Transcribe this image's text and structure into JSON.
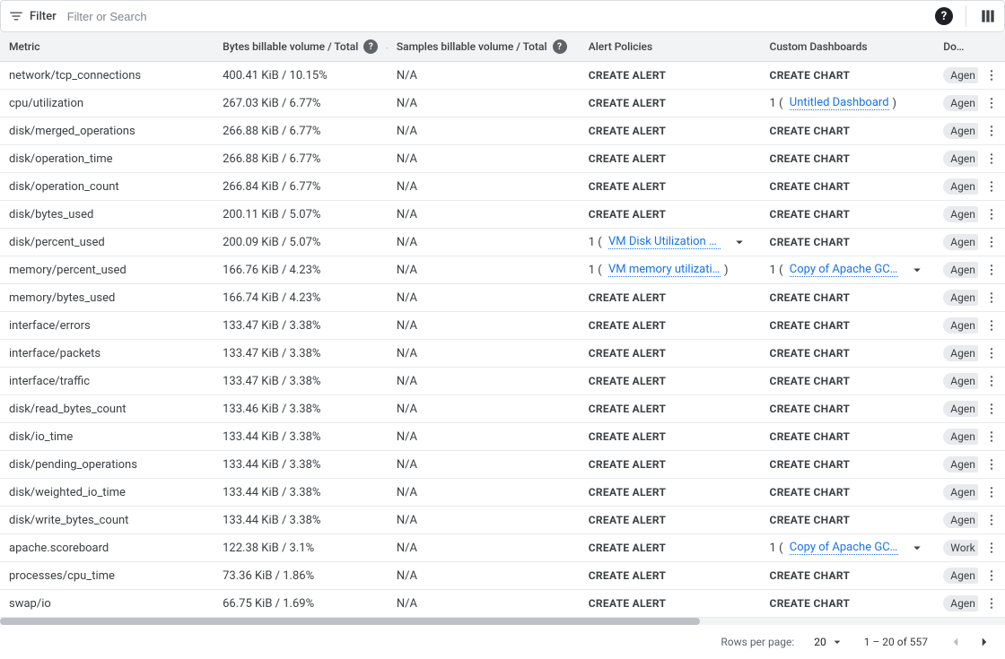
{
  "filter": {
    "label": "Filter",
    "placeholder": "Filter or Search"
  },
  "columns": {
    "metric": "Metric",
    "bytes": "Bytes billable volume / Total",
    "samples": "Samples billable volume / Total",
    "alert": "Alert Policies",
    "dash": "Custom Dashboards",
    "domain": "Domain"
  },
  "labels": {
    "create_alert": "CREATE ALERT",
    "create_chart": "CREATE CHART"
  },
  "rows": [
    {
      "metric": "network/tcp_connections",
      "bytes": "400.41 KiB / 10.15%",
      "samples": "N/A",
      "alert": null,
      "dash": null,
      "domain": "Agen"
    },
    {
      "metric": "cpu/utilization",
      "bytes": "267.03 KiB / 6.77%",
      "samples": "N/A",
      "alert": null,
      "dash": {
        "count": "1",
        "link": "Untitled Dashboard",
        "suffix": ")",
        "expand": false
      },
      "domain": "Agen"
    },
    {
      "metric": "disk/merged_operations",
      "bytes": "266.88 KiB / 6.77%",
      "samples": "N/A",
      "alert": null,
      "dash": null,
      "domain": "Agen"
    },
    {
      "metric": "disk/operation_time",
      "bytes": "266.88 KiB / 6.77%",
      "samples": "N/A",
      "alert": null,
      "dash": null,
      "domain": "Agen"
    },
    {
      "metric": "disk/operation_count",
      "bytes": "266.84 KiB / 6.77%",
      "samples": "N/A",
      "alert": null,
      "dash": null,
      "domain": "Agen"
    },
    {
      "metric": "disk/bytes_used",
      "bytes": "200.11 KiB / 5.07%",
      "samples": "N/A",
      "alert": null,
      "dash": null,
      "domain": "Agen"
    },
    {
      "metric": "disk/percent_used",
      "bytes": "200.09 KiB / 5.07%",
      "samples": "N/A",
      "alert": {
        "count": "1",
        "link": "VM Disk Utilization about …",
        "suffix": "",
        "expand": true
      },
      "dash": null,
      "domain": "Agen"
    },
    {
      "metric": "memory/percent_used",
      "bytes": "166.76 KiB / 4.23%",
      "samples": "N/A",
      "alert": {
        "count": "1",
        "link": "VM memory utilization too high",
        "suffix": ")",
        "expand": false
      },
      "dash": {
        "count": "1",
        "link": "Copy of Apache GCE Over…",
        "suffix": "",
        "expand": true
      },
      "domain": "Agen"
    },
    {
      "metric": "memory/bytes_used",
      "bytes": "166.74 KiB / 4.23%",
      "samples": "N/A",
      "alert": null,
      "dash": null,
      "domain": "Agen"
    },
    {
      "metric": "interface/errors",
      "bytes": "133.47 KiB / 3.38%",
      "samples": "N/A",
      "alert": null,
      "dash": null,
      "domain": "Agen"
    },
    {
      "metric": "interface/packets",
      "bytes": "133.47 KiB / 3.38%",
      "samples": "N/A",
      "alert": null,
      "dash": null,
      "domain": "Agen"
    },
    {
      "metric": "interface/traffic",
      "bytes": "133.47 KiB / 3.38%",
      "samples": "N/A",
      "alert": null,
      "dash": null,
      "domain": "Agen"
    },
    {
      "metric": "disk/read_bytes_count",
      "bytes": "133.46 KiB / 3.38%",
      "samples": "N/A",
      "alert": null,
      "dash": null,
      "domain": "Agen"
    },
    {
      "metric": "disk/io_time",
      "bytes": "133.44 KiB / 3.38%",
      "samples": "N/A",
      "alert": null,
      "dash": null,
      "domain": "Agen"
    },
    {
      "metric": "disk/pending_operations",
      "bytes": "133.44 KiB / 3.38%",
      "samples": "N/A",
      "alert": null,
      "dash": null,
      "domain": "Agen"
    },
    {
      "metric": "disk/weighted_io_time",
      "bytes": "133.44 KiB / 3.38%",
      "samples": "N/A",
      "alert": null,
      "dash": null,
      "domain": "Agen"
    },
    {
      "metric": "disk/write_bytes_count",
      "bytes": "133.44 KiB / 3.38%",
      "samples": "N/A",
      "alert": null,
      "dash": null,
      "domain": "Agen"
    },
    {
      "metric": "apache.scoreboard",
      "bytes": "122.38 KiB / 3.1%",
      "samples": "N/A",
      "alert": null,
      "dash": {
        "count": "1",
        "link": "Copy of Apache GCE Over…",
        "suffix": "",
        "expand": true
      },
      "domain": "Work"
    },
    {
      "metric": "processes/cpu_time",
      "bytes": "73.36 KiB / 1.86%",
      "samples": "N/A",
      "alert": null,
      "dash": null,
      "domain": "Agen"
    },
    {
      "metric": "swap/io",
      "bytes": "66.75 KiB / 1.69%",
      "samples": "N/A",
      "alert": null,
      "dash": null,
      "domain": "Agen"
    }
  ],
  "pager": {
    "rows_label": "Rows per page:",
    "rows_value": "20",
    "range": "1 – 20 of 557"
  }
}
